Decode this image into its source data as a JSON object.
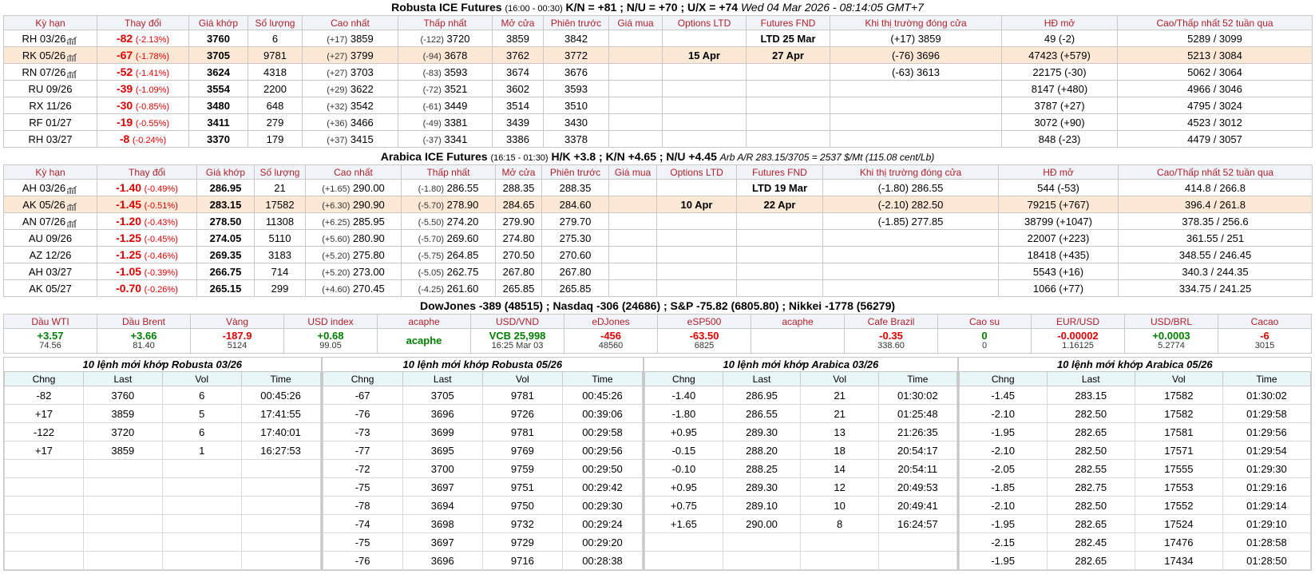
{
  "robusta": {
    "title": "Robusta ICE Futures",
    "hours": "(16:00 - 00:30)",
    "spreads": "K/N = +81 ; N/U = +70 ; U/X = +74",
    "timestamp": "Wed 04 Mar 2026 - 08:14:05 GMT+7",
    "headers": [
      "Kỳ hạn",
      "Thay đổi",
      "Giá khớp",
      "Số lượng",
      "Cao nhất",
      "Thấp nhất",
      "Mở cửa",
      "Phiên trước",
      "Giá mua",
      "Options LTD",
      "Futures FND",
      "Khi thị trường đóng cửa",
      "HĐ mở",
      "Cao/Thấp nhất 52 tuần qua"
    ],
    "rows": [
      {
        "term": "RH 03/26",
        "chg": "-82",
        "pct": "(-2.13%)",
        "price": "3760",
        "vol": "6",
        "hi_d": "(+17)",
        "hi": "3859",
        "lo_d": "(-122)",
        "lo": "3720",
        "open": "3859",
        "prev": "3842",
        "bid": "",
        "opt": "",
        "fnd": "LTD 25 Mar",
        "close": "(+17) 3859",
        "oi": "49 (-2)",
        "w52": "5289 / 3099"
      },
      {
        "term": "RK 05/26",
        "chg": "-67",
        "pct": "(-1.78%)",
        "price": "3705",
        "vol": "9781",
        "hi_d": "(+27)",
        "hi": "3799",
        "lo_d": "(-94)",
        "lo": "3678",
        "open": "3762",
        "prev": "3772",
        "bid": "",
        "opt": "15 Apr",
        "fnd": "27 Apr",
        "close": "(-76) 3696",
        "oi": "47423 (+579)",
        "w52": "5213 / 3084"
      },
      {
        "term": "RN 07/26",
        "chg": "-52",
        "pct": "(-1.41%)",
        "price": "3624",
        "vol": "4318",
        "hi_d": "(+27)",
        "hi": "3703",
        "lo_d": "(-83)",
        "lo": "3593",
        "open": "3674",
        "prev": "3676",
        "bid": "",
        "opt": "",
        "fnd": "",
        "close": "(-63) 3613",
        "oi": "22175 (-30)",
        "w52": "5062 / 3064"
      },
      {
        "term": "RU 09/26",
        "chg": "-39",
        "pct": "(-1.09%)",
        "price": "3554",
        "vol": "2200",
        "hi_d": "(+29)",
        "hi": "3622",
        "lo_d": "(-72)",
        "lo": "3521",
        "open": "3602",
        "prev": "3593",
        "bid": "",
        "opt": "",
        "fnd": "",
        "close": "",
        "oi": "8147 (+480)",
        "w52": "4966 / 3046"
      },
      {
        "term": "RX 11/26",
        "chg": "-30",
        "pct": "(-0.85%)",
        "price": "3480",
        "vol": "648",
        "hi_d": "(+32)",
        "hi": "3542",
        "lo_d": "(-61)",
        "lo": "3449",
        "open": "3514",
        "prev": "3510",
        "bid": "",
        "opt": "",
        "fnd": "",
        "close": "",
        "oi": "3787 (+27)",
        "w52": "4795 / 3024"
      },
      {
        "term": "RF 01/27",
        "chg": "-19",
        "pct": "(-0.55%)",
        "price": "3411",
        "vol": "279",
        "hi_d": "(+36)",
        "hi": "3466",
        "lo_d": "(-49)",
        "lo": "3381",
        "open": "3439",
        "prev": "3430",
        "bid": "",
        "opt": "",
        "fnd": "",
        "close": "",
        "oi": "3072 (+90)",
        "w52": "4523 / 3012"
      },
      {
        "term": "RH 03/27",
        "chg": "-8",
        "pct": "(-0.24%)",
        "price": "3370",
        "vol": "179",
        "hi_d": "(+37)",
        "hi": "3415",
        "lo_d": "(-37)",
        "lo": "3341",
        "open": "3386",
        "prev": "3378",
        "bid": "",
        "opt": "",
        "fnd": "",
        "close": "",
        "oi": "848 (-23)",
        "w52": "4479 / 3057"
      }
    ]
  },
  "arabica": {
    "title": "Arabica ICE Futures",
    "hours": "(16:15 - 01:30)",
    "spreads": "H/K +3.8 ; K/N +4.65 ; N/U +4.45",
    "arb": "Arb A/R 283.15/3705 = 2537 $/Mt (115.08 cent/Lb)",
    "headers": [
      "Kỳ hạn",
      "Thay đổi",
      "Giá khớp",
      "Số lượng",
      "Cao nhất",
      "Thấp nhất",
      "Mở cửa",
      "Phiên trước",
      "Giá mua",
      "Options LTD",
      "Futures FND",
      "Khi thị trường đóng cửa",
      "HĐ mở",
      "Cao/Thấp nhất 52 tuần qua"
    ],
    "rows": [
      {
        "term": "AH 03/26",
        "chg": "-1.40",
        "pct": "(-0.49%)",
        "price": "286.95",
        "vol": "21",
        "hi_d": "(+1.65)",
        "hi": "290.00",
        "lo_d": "(-1.80)",
        "lo": "286.55",
        "open": "288.35",
        "prev": "288.35",
        "bid": "",
        "opt": "",
        "fnd": "LTD 19 Mar",
        "close": "(-1.80) 286.55",
        "oi": "544 (-53)",
        "w52": "414.8 / 266.8"
      },
      {
        "term": "AK 05/26",
        "chg": "-1.45",
        "pct": "(-0.51%)",
        "price": "283.15",
        "vol": "17582",
        "hi_d": "(+6.30)",
        "hi": "290.90",
        "lo_d": "(-5.70)",
        "lo": "278.90",
        "open": "284.65",
        "prev": "284.60",
        "bid": "",
        "opt": "10 Apr",
        "fnd": "22 Apr",
        "close": "(-2.10) 282.50",
        "oi": "79215 (+767)",
        "w52": "396.4 / 261.8"
      },
      {
        "term": "AN 07/26",
        "chg": "-1.20",
        "pct": "(-0.43%)",
        "price": "278.50",
        "vol": "11308",
        "hi_d": "(+6.25)",
        "hi": "285.95",
        "lo_d": "(-5.50)",
        "lo": "274.20",
        "open": "279.90",
        "prev": "279.70",
        "bid": "",
        "opt": "",
        "fnd": "",
        "close": "(-1.85) 277.85",
        "oi": "38799 (+1047)",
        "w52": "378.35 / 256.6"
      },
      {
        "term": "AU 09/26",
        "chg": "-1.25",
        "pct": "(-0.45%)",
        "price": "274.05",
        "vol": "5110",
        "hi_d": "(+5.60)",
        "hi": "280.90",
        "lo_d": "(-5.70)",
        "lo": "269.60",
        "open": "274.80",
        "prev": "275.30",
        "bid": "",
        "opt": "",
        "fnd": "",
        "close": "",
        "oi": "22007 (+223)",
        "w52": "361.55 / 251"
      },
      {
        "term": "AZ 12/26",
        "chg": "-1.25",
        "pct": "(-0.46%)",
        "price": "269.35",
        "vol": "3183",
        "hi_d": "(+5.20)",
        "hi": "275.80",
        "lo_d": "(-5.75)",
        "lo": "264.85",
        "open": "270.50",
        "prev": "270.60",
        "bid": "",
        "opt": "",
        "fnd": "",
        "close": "",
        "oi": "18418 (+435)",
        "w52": "348.55 / 246.45"
      },
      {
        "term": "AH 03/27",
        "chg": "-1.05",
        "pct": "(-0.39%)",
        "price": "266.75",
        "vol": "714",
        "hi_d": "(+5.20)",
        "hi": "273.00",
        "lo_d": "(-5.05)",
        "lo": "262.75",
        "open": "267.80",
        "prev": "267.80",
        "bid": "",
        "opt": "",
        "fnd": "",
        "close": "",
        "oi": "5543 (+16)",
        "w52": "340.3 / 244.35"
      },
      {
        "term": "AK 05/27",
        "chg": "-0.70",
        "pct": "(-0.26%)",
        "price": "265.15",
        "vol": "299",
        "hi_d": "(+4.60)",
        "hi": "270.45",
        "lo_d": "(-4.25)",
        "lo": "261.60",
        "open": "265.85",
        "prev": "265.85",
        "bid": "",
        "opt": "",
        "fnd": "",
        "close": "",
        "oi": "1066 (+77)",
        "w52": "334.75 / 241.25"
      }
    ]
  },
  "indices": "DowJones -389 (48515) ; Nasdaq -306 (24686) ; S&P -75.82 (6805.80) ; Nikkei -1778 (56279)",
  "markets": {
    "headers": [
      "Dầu WTI",
      "Dầu Brent",
      "Vàng",
      "USD index",
      "acaphe",
      "USD/VND",
      "eDJones",
      "eSP500",
      "acaphe",
      "Cafe Brazil",
      "Cao su",
      "EUR/USD",
      "USD/BRL",
      "Cacao"
    ],
    "cells": [
      {
        "main": "+3.57",
        "sub": "74.56",
        "color": "green"
      },
      {
        "main": "+3.66",
        "sub": "81.40",
        "color": "green"
      },
      {
        "main": "-187.9",
        "sub": "5124",
        "color": "red"
      },
      {
        "main": "+0.68",
        "sub": "99.05",
        "color": "green"
      },
      {
        "main": "acaphe",
        "sub": "",
        "color": "green"
      },
      {
        "main": "VCB 25,998",
        "sub": "16:25 Mar 03",
        "color": "green"
      },
      {
        "main": "-456",
        "sub": "48560",
        "color": "red"
      },
      {
        "main": "-63.50",
        "sub": "6825",
        "color": "red"
      },
      {
        "main": "",
        "sub": "",
        "color": "green"
      },
      {
        "main": "-0.35",
        "sub": "338.60",
        "color": "red"
      },
      {
        "main": "0",
        "sub": "0",
        "color": "green"
      },
      {
        "main": "-0.00002",
        "sub": "1.16125",
        "color": "red"
      },
      {
        "main": "+0.0003",
        "sub": "5.2774",
        "color": "green"
      },
      {
        "main": "-6",
        "sub": "3015",
        "color": "red"
      }
    ]
  },
  "trade_blocks": [
    {
      "title": "10 lệnh mới khớp Robusta 03/26",
      "headers": [
        "Chng",
        "Last",
        "Vol",
        "Time"
      ],
      "rows": [
        [
          "-82",
          "3760",
          "6",
          "00:45:26"
        ],
        [
          "+17",
          "3859",
          "5",
          "17:41:55"
        ],
        [
          "-122",
          "3720",
          "6",
          "17:40:01"
        ],
        [
          "+17",
          "3859",
          "1",
          "16:27:53"
        ],
        [
          "",
          "",
          "",
          ""
        ],
        [
          "",
          "",
          "",
          ""
        ],
        [
          "",
          "",
          "",
          ""
        ],
        [
          "",
          "",
          "",
          ""
        ],
        [
          "",
          "",
          "",
          ""
        ],
        [
          "",
          "",
          "",
          ""
        ]
      ]
    },
    {
      "title": "10 lệnh mới khớp Robusta 05/26",
      "headers": [
        "Chng",
        "Last",
        "Vol",
        "Time"
      ],
      "rows": [
        [
          "-67",
          "3705",
          "9781",
          "00:45:26"
        ],
        [
          "-76",
          "3696",
          "9726",
          "00:39:06"
        ],
        [
          "-73",
          "3699",
          "9781",
          "00:29:58"
        ],
        [
          "-77",
          "3695",
          "9769",
          "00:29:56"
        ],
        [
          "-72",
          "3700",
          "9759",
          "00:29:50"
        ],
        [
          "-75",
          "3697",
          "9751",
          "00:29:42"
        ],
        [
          "-78",
          "3694",
          "9750",
          "00:29:30"
        ],
        [
          "-74",
          "3698",
          "9732",
          "00:29:24"
        ],
        [
          "-75",
          "3697",
          "9729",
          "00:29:20"
        ],
        [
          "-76",
          "3696",
          "9716",
          "00:28:38"
        ]
      ]
    },
    {
      "title": "10 lệnh mới khớp Arabica 03/26",
      "headers": [
        "Chng",
        "Last",
        "Vol",
        "Time"
      ],
      "rows": [
        [
          "-1.40",
          "286.95",
          "21",
          "01:30:02"
        ],
        [
          "-1.80",
          "286.55",
          "21",
          "01:25:48"
        ],
        [
          "+0.95",
          "289.30",
          "13",
          "21:26:35"
        ],
        [
          "-0.15",
          "288.20",
          "18",
          "20:54:17"
        ],
        [
          "-0.10",
          "288.25",
          "14",
          "20:54:11"
        ],
        [
          "+0.95",
          "289.30",
          "12",
          "20:49:53"
        ],
        [
          "+0.75",
          "289.10",
          "10",
          "20:49:41"
        ],
        [
          "+1.65",
          "290.00",
          "8",
          "16:24:57"
        ],
        [
          "",
          "",
          "",
          ""
        ],
        [
          "",
          "",
          "",
          ""
        ]
      ]
    },
    {
      "title": "10 lệnh mới khớp Arabica 05/26",
      "headers": [
        "Chng",
        "Last",
        "Vol",
        "Time"
      ],
      "rows": [
        [
          "-1.45",
          "283.15",
          "17582",
          "01:30:02"
        ],
        [
          "-2.10",
          "282.50",
          "17582",
          "01:29:58"
        ],
        [
          "-1.95",
          "282.65",
          "17581",
          "01:29:56"
        ],
        [
          "-2.10",
          "282.50",
          "17571",
          "01:29:54"
        ],
        [
          "-2.05",
          "282.55",
          "17555",
          "01:29:30"
        ],
        [
          "-1.85",
          "282.75",
          "17553",
          "01:29:16"
        ],
        [
          "-2.10",
          "282.50",
          "17552",
          "01:29:14"
        ],
        [
          "-1.95",
          "282.65",
          "17524",
          "01:29:10"
        ],
        [
          "-2.15",
          "282.45",
          "17476",
          "01:28:58"
        ],
        [
          "-1.95",
          "282.65",
          "17434",
          "01:28:50"
        ]
      ]
    }
  ],
  "colors": {
    "header_text": "#b0202a",
    "header_bg": "#f0f4f8",
    "highlight_row": "#fde8d6",
    "negative": "#e00000",
    "positive": "#008000",
    "trade_header_bg": "#e8f6f8"
  }
}
